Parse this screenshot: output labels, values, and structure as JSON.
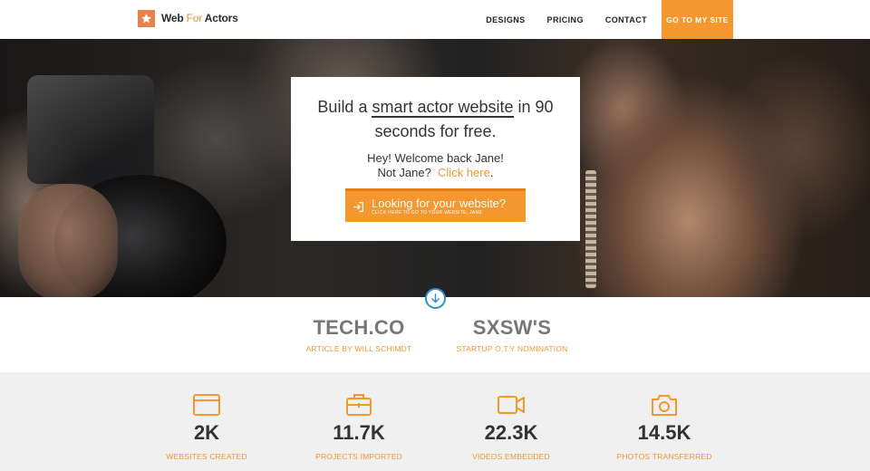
{
  "header": {
    "logo": {
      "text_main": "Web",
      "text_for": "For",
      "text_end": "Actors",
      "icon": "star-icon",
      "accent": "#e8824a"
    },
    "nav": [
      {
        "label": "DESIGNS"
      },
      {
        "label": "PRICING"
      },
      {
        "label": "CONTACT"
      }
    ],
    "cta_label": "GO TO MY SITE"
  },
  "hero": {
    "title_before": "Build a ",
    "title_highlight": "smart actor website",
    "title_after": " in 90 seconds for free.",
    "welcome_line": "Hey! Welcome back Jane!",
    "not_user": "Not Jane?",
    "click_here": "Click here",
    "click_suffix": ".",
    "button_main": "Looking for your website?",
    "button_sub": "CLICK HERE TO GO TO YOUR WEBSITE, JANE",
    "button_icon": "enter-icon",
    "scroll_icon": "arrow-down-circle-icon"
  },
  "press": [
    {
      "name": "TECH.CO",
      "caption": "ARTICLE BY WILL SCHIMDT"
    },
    {
      "name": "SXSW'S",
      "caption": "STARTUP O.T.Y NOMINATION"
    }
  ],
  "stats": [
    {
      "icon": "browser-window-icon",
      "value": "2K",
      "label": "WEBSITES CREATED"
    },
    {
      "icon": "briefcase-icon",
      "value": "11.7K",
      "label": "PROJECTS IMPORTED"
    },
    {
      "icon": "video-camera-icon",
      "value": "22.3K",
      "label": "VIDEOS EMBEDDED"
    },
    {
      "icon": "photo-camera-icon",
      "value": "14.5K",
      "label": "PHOTOS TRANSFERRED"
    }
  ],
  "colors": {
    "accent": "#f4972e",
    "accent_dark": "#e77d17",
    "scroll_ring": "#2f8fd0",
    "stats_bg": "#f0f0f0"
  }
}
